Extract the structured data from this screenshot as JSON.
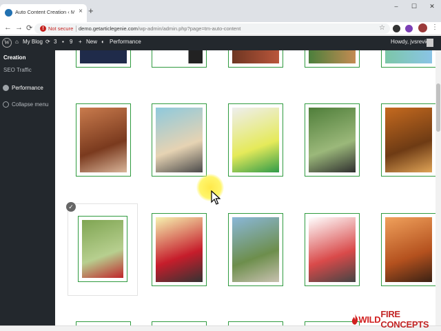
{
  "browser": {
    "tab_title": "Auto Content Creation ‹ My Blog",
    "tab_close": "×",
    "new_tab": "+",
    "window_controls": [
      "–",
      "☐",
      "✕"
    ],
    "nav": {
      "back": "←",
      "forward": "→",
      "reload": "⟳"
    },
    "security_label": "Not secure",
    "url_host": "demo.getarticlegenie.com",
    "url_path": "/wp-admin/admin.php?page=tm-auto-content",
    "star": "☆",
    "menu": "⋮"
  },
  "adminbar": {
    "logo": "W",
    "site_name": "My Blog",
    "updates_count": "3",
    "comments_count": "9",
    "new_label": "New",
    "performance_label": "Performance",
    "howdy": "Howdy, jvsreview"
  },
  "sidebar": {
    "items": [
      {
        "label": "Creation",
        "active": true
      },
      {
        "label": "SEO Traffic",
        "active": false
      },
      {
        "label": "Performance",
        "active": false
      },
      {
        "label": "Collapse menu",
        "active": false
      }
    ]
  },
  "grid": {
    "selected_check": "✓",
    "images": [
      {
        "icon": "rusty-sculpture-image",
        "colors": [
          "#c97b4d",
          "#7a3a1e",
          "#d9b59a"
        ]
      },
      {
        "icon": "beach-children-image",
        "colors": [
          "#8ec9dc",
          "#e6d3b3",
          "#4a4a4a"
        ]
      },
      {
        "icon": "hello-text-image",
        "colors": [
          "#eeeeee",
          "#e5ea5a",
          "#2f9b49"
        ]
      },
      {
        "icon": "man-binoculars-image",
        "colors": [
          "#4f7e3a",
          "#9bb87a",
          "#2f2f2f"
        ]
      },
      {
        "icon": "balancing-stone-image",
        "colors": [
          "#c56a1f",
          "#6e3b14",
          "#e0a457"
        ]
      },
      {
        "icon": "woman-running-image",
        "colors": [
          "#7fa552",
          "#b7cf8f",
          "#c0262b"
        ]
      },
      {
        "icon": "man-exercise-bike-image",
        "colors": [
          "#f6f3b0",
          "#c61d2b",
          "#333333"
        ]
      },
      {
        "icon": "mountain-road-image",
        "colors": [
          "#8ab7d8",
          "#6d8e4c",
          "#c8c1b0"
        ]
      },
      {
        "icon": "woman-kitchen-drawing-image",
        "colors": [
          "#ffffff",
          "#d94a4a",
          "#444444"
        ]
      },
      {
        "icon": "stacked-stones-image",
        "colors": [
          "#f0a15c",
          "#b4511e",
          "#3a2114"
        ]
      }
    ]
  },
  "branding": {
    "text_wild": "WILD",
    "text_rest": "FIRE CONCEPTS"
  },
  "colors": {
    "admin_bg": "#23282d",
    "card_border": "#2e9a3e",
    "warning_red": "#c5221f",
    "highlight": "#fff56b"
  }
}
